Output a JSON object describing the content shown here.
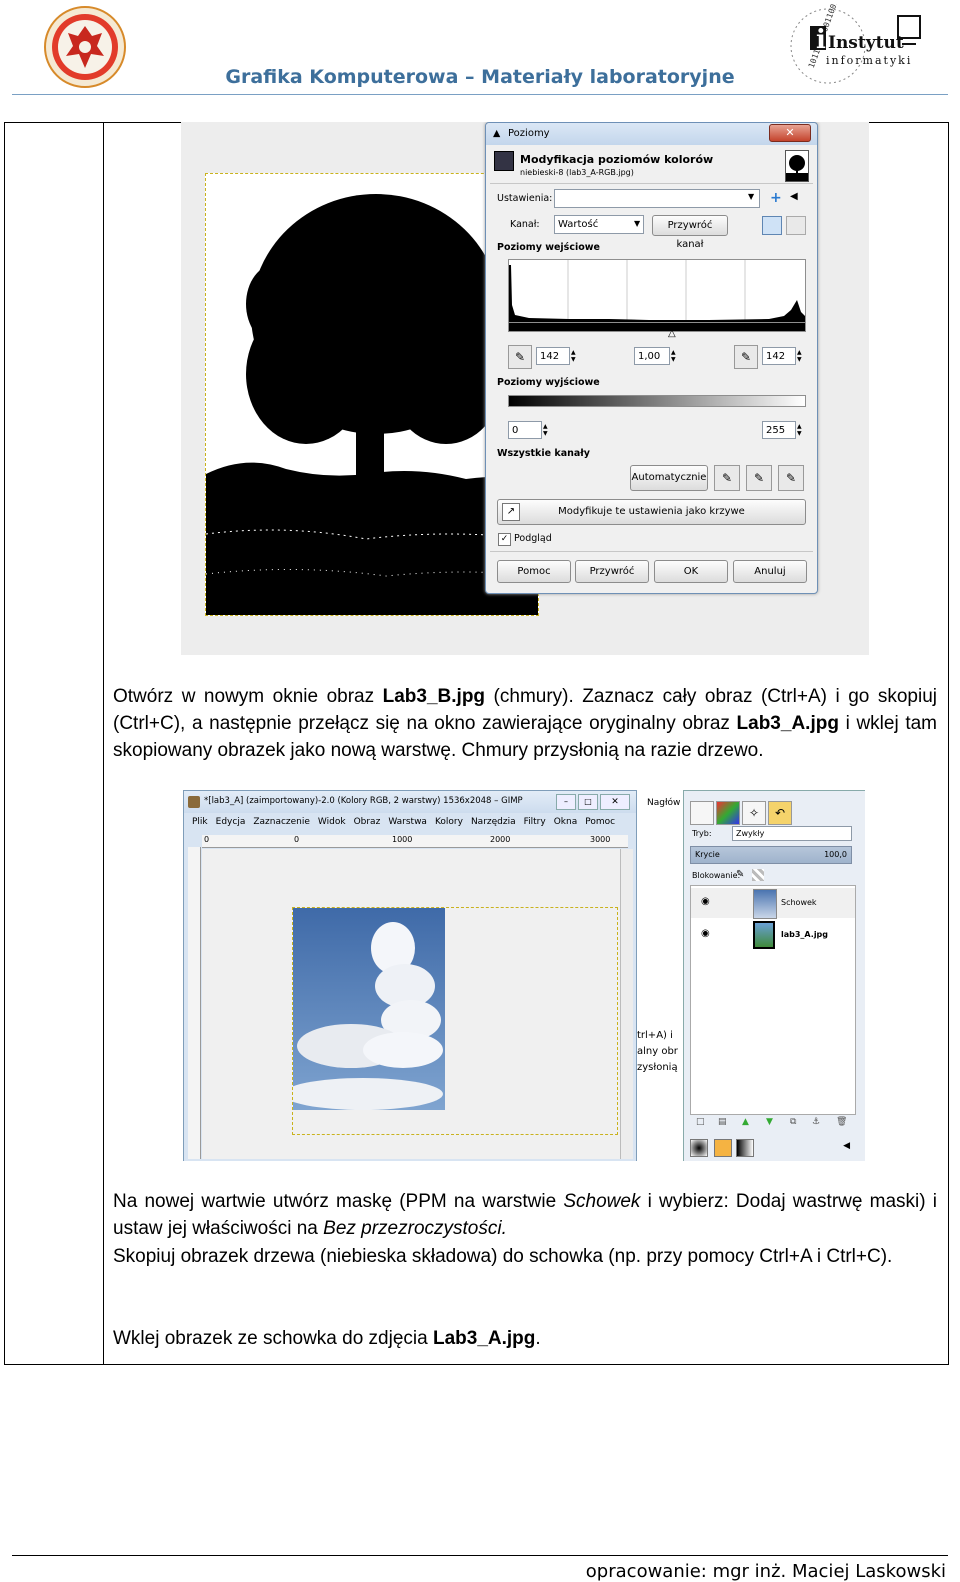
{
  "header": {
    "title": "Grafika Komputerowa – Materiały laboratoryjne",
    "logo_right_brand": "Instytut",
    "logo_right_sub": "informatyki",
    "logo_right_binary": "10110100001100101"
  },
  "levels_dialog": {
    "window_title": "Poziomy",
    "heading": "Modyfikacja poziomów kolorów",
    "subheading": "niebieski-8 (lab3_A-RGB.jpg)",
    "settings_label": "Ustawienia:",
    "channel_label": "Kanał:",
    "channel_value": "Wartość",
    "reset_channel_button": "Przywróć kanał",
    "input_levels_label": "Poziomy wejściowe",
    "input_low": "142",
    "input_gamma": "1,00",
    "input_high": "142",
    "output_levels_label": "Poziomy wyjściowe",
    "output_low": "0",
    "output_high": "255",
    "all_channels_label": "Wszystkie kanały",
    "auto_button": "Automatycznie",
    "curves_button": "Modyfikuje te ustawienia jako krzywe",
    "preview_label": "Podgląd",
    "help_button": "Pomoc",
    "reset_button": "Przywróć",
    "ok_button": "OK",
    "cancel_button": "Anuluj"
  },
  "paragraph1": {
    "t1": "Otwórz w nowym oknie obraz ",
    "b1": "Lab3_B.jpg",
    "t2": " (chmury). Zaznacz cały obraz (Ctrl+A) i go skopiuj (Ctrl+C), a następnie przełącz się na okno zawierające oryginalny obraz ",
    "b2": "Lab3_A.jpg",
    "t3": " i wklej tam skopiowany obrazek jako nową warstwę. Chmury przysłonią na razie drzewo."
  },
  "gimp_window": {
    "title": "*[lab3_A] (zaimportowany)-2.0 (Kolory RGB, 2 warstwy) 1536x2048 – GIMP",
    "menu": [
      "Plik",
      "Edycja",
      "Zaznaczenie",
      "Widok",
      "Obraz",
      "Warstwa",
      "Kolory",
      "Narzędzia",
      "Filtry",
      "Okna",
      "Pomoc"
    ],
    "ruler_ticks": [
      "0",
      "1000",
      "2000",
      "3000"
    ],
    "behind_title": "Nagłów",
    "behind_snippets": [
      "trl+A)  i",
      "alny  obr",
      "zysłonią"
    ]
  },
  "layers_panel": {
    "mode_label": "Tryb:",
    "mode_value": "Zwykły",
    "opacity_label": "Krycie",
    "opacity_value": "100,0",
    "lock_label": "Blokowanie:",
    "layers": [
      "Schowek",
      "lab3_A.jpg"
    ]
  },
  "paragraph2": {
    "t1": "Na nowej wartwie utwórz maskę (PPM na warstwie ",
    "i1": "Schowek",
    "t2": " i wybierz: Dodaj wastrwę maski) i ustaw jej właściwości na ",
    "i2": "Bez przezroczystości."
  },
  "paragraph3": {
    "text": "Skopiuj obrazek drzewa (niebieska składowa) do schowka (np. przy pomocy Ctrl+A i Ctrl+C)."
  },
  "paragraph4": {
    "t1": "Wklej obrazek ze schowka do zdjęcia ",
    "b1": "Lab3_A.jpg",
    "t2": "."
  },
  "footer": {
    "author": "opracowanie: mgr inż. Maciej Laskowski"
  },
  "colors": {
    "header_title": "#3d6f9b",
    "dialog_border": "#6e90b6",
    "sky": "#4d78b4"
  }
}
